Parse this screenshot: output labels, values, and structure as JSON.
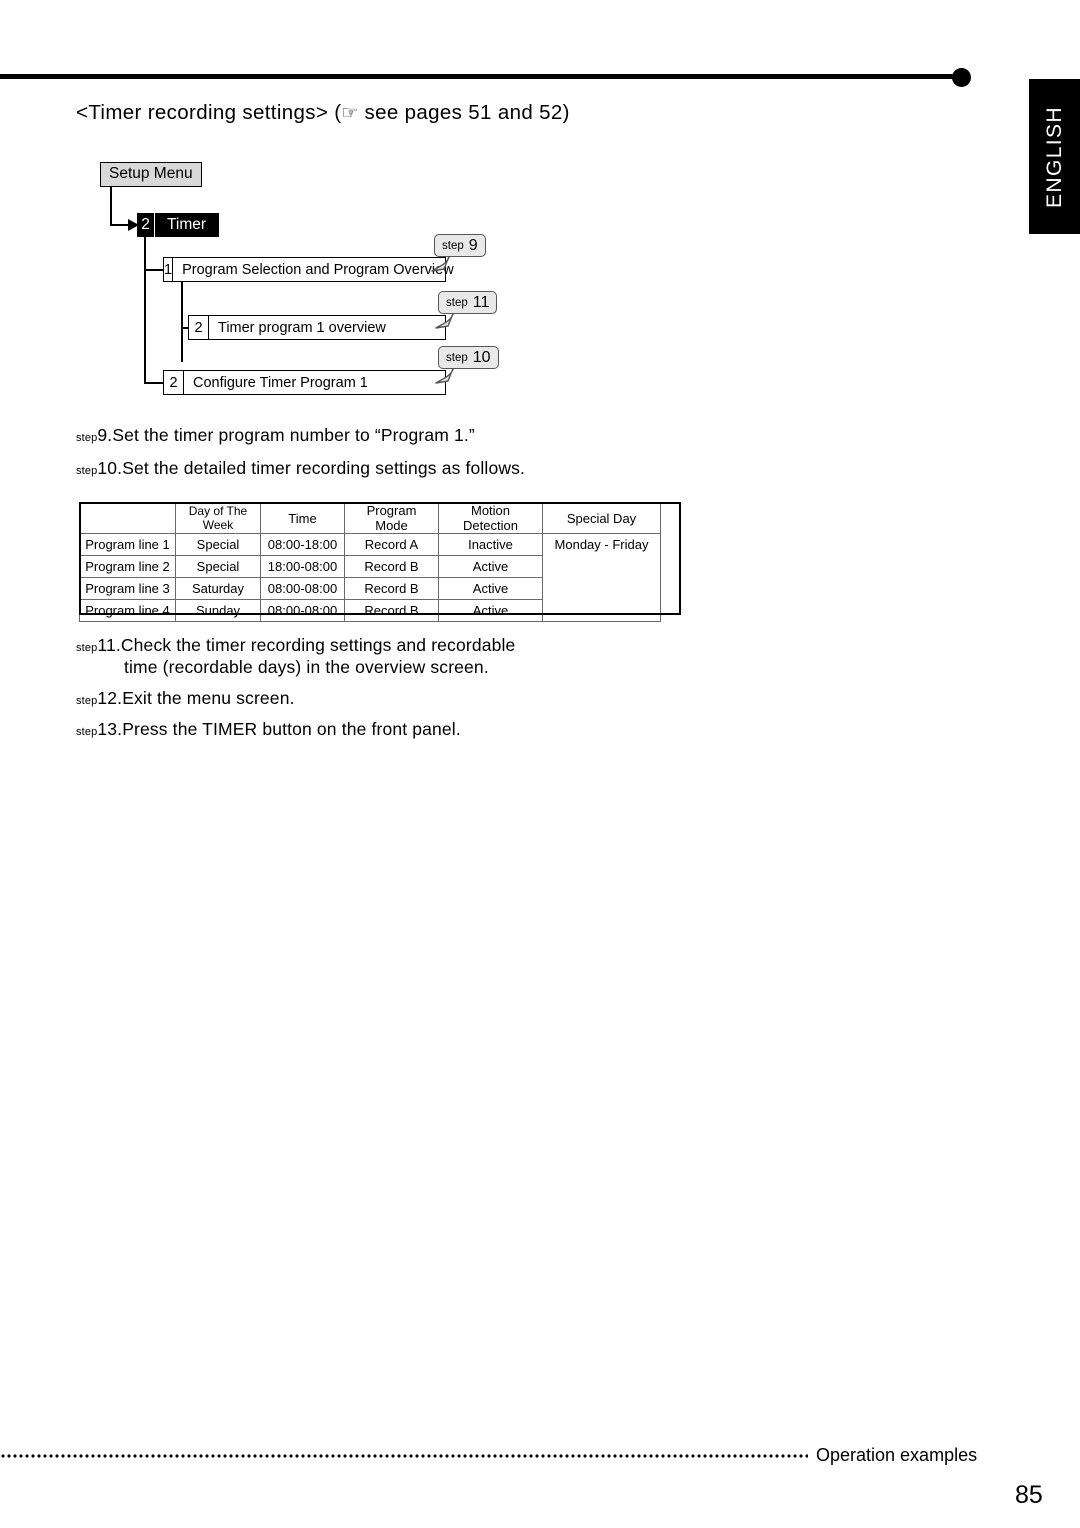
{
  "page": {
    "language_tab": "ENGLISH",
    "heading_prefix": "<Timer recording settings> (",
    "heading_icon": "☞",
    "heading_suffix": " see pages 51 and 52)",
    "footer_label": "Operation examples",
    "page_number": "85"
  },
  "diagram": {
    "setup_menu": "Setup Menu",
    "timer_node": {
      "number": "2",
      "label": "Timer"
    },
    "nodes": [
      {
        "number": "1",
        "label": "Program Selection and Program Overview"
      },
      {
        "number": "2",
        "label": "Timer program 1 overview"
      },
      {
        "number": "2",
        "label": "Configure Timer Program 1"
      }
    ],
    "callouts": [
      {
        "word": "step",
        "number": "9"
      },
      {
        "word": "step",
        "number": "11"
      },
      {
        "word": "step",
        "number": "10"
      }
    ]
  },
  "steps": [
    {
      "word": "step",
      "number": "9.",
      "text": "Set the timer program number to “Program 1.”"
    },
    {
      "word": "step",
      "number": "10.",
      "text": "Set the detailed timer recording settings as follows."
    },
    {
      "word": "step",
      "number": "11.",
      "text": "Check the timer recording settings and recordable",
      "text2": "time (recordable days) in the overview screen."
    },
    {
      "word": "step",
      "number": "12.",
      "text": "Exit the menu screen."
    },
    {
      "word": "step",
      "number": "13.",
      "text": "Press the TIMER button on the front panel."
    }
  ],
  "table": {
    "headers": [
      "",
      "Day of The Week",
      "Time",
      "Program Mode",
      "Motion Detection",
      "Special Day"
    ],
    "rows": [
      {
        "line": "Program line 1",
        "day": "Special",
        "time": "08:00-18:00",
        "mode": "Record A",
        "motion": "Inactive"
      },
      {
        "line": "Program line 2",
        "day": "Special",
        "time": "18:00-08:00",
        "mode": "Record B",
        "motion": "Active"
      },
      {
        "line": "Program line 3",
        "day": "Saturday",
        "time": "08:00-08:00",
        "mode": "Record B",
        "motion": "Active"
      },
      {
        "line": "Program line 4",
        "day": "Sunday",
        "time": "08:00-08:00",
        "mode": "Record B",
        "motion": "Active"
      }
    ],
    "special_day": "Monday - Friday"
  }
}
